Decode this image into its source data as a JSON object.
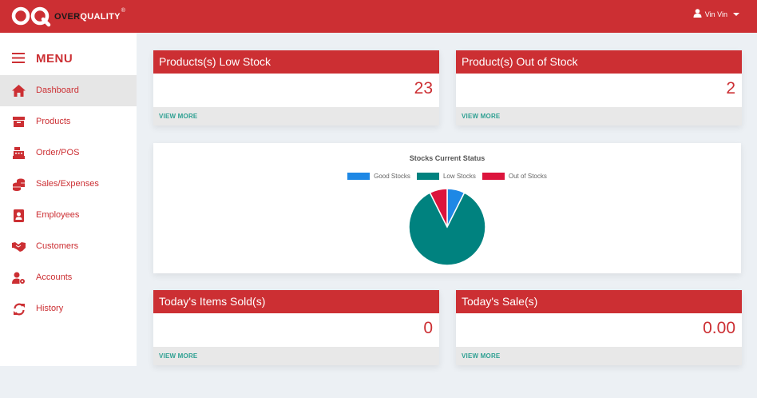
{
  "header": {
    "brand_left": "OVER",
    "brand_right": "QUALITY",
    "brand_mark": "R",
    "user_name": "Vin Vin"
  },
  "sidebar": {
    "title": "MENU",
    "items": [
      {
        "label": "Dashboard",
        "icon": "home-icon",
        "active": true
      },
      {
        "label": "Products",
        "icon": "archive-box-icon"
      },
      {
        "label": "Order/POS",
        "icon": "cash-register-icon"
      },
      {
        "label": "Sales/Expenses",
        "icon": "coins-icon"
      },
      {
        "label": "Employees",
        "icon": "id-badge-icon"
      },
      {
        "label": "Customers",
        "icon": "handshake-icon"
      },
      {
        "label": "Accounts",
        "icon": "user-gear-icon"
      },
      {
        "label": "History",
        "icon": "sync-icon"
      }
    ]
  },
  "cards": {
    "low_stock": {
      "title": "Products(s) Low Stock",
      "value": "23",
      "footer": "VIEW MORE"
    },
    "out_of_stock": {
      "title": "Product(s) Out of Stock",
      "value": "2",
      "footer": "VIEW MORE"
    },
    "items_sold": {
      "title": "Today's Items Sold(s)",
      "value": "0",
      "footer": "VIEW MORE"
    },
    "sales": {
      "title": "Today's Sale(s)",
      "value": "0.00",
      "footer": "VIEW MORE"
    }
  },
  "colors": {
    "brand_red": "#cc2f33",
    "good": "#1e88e5",
    "low": "#00827f",
    "out": "#dc143c",
    "link_teal": "#2ea092"
  },
  "chart_data": {
    "type": "pie",
    "title": "Stocks Current Status",
    "categories": [
      "Good Stocks",
      "Low Stocks",
      "Out of Stocks"
    ],
    "values": [
      2,
      23,
      2
    ],
    "colors": [
      "#1e88e5",
      "#00827f",
      "#dc143c"
    ],
    "legend": "top"
  }
}
